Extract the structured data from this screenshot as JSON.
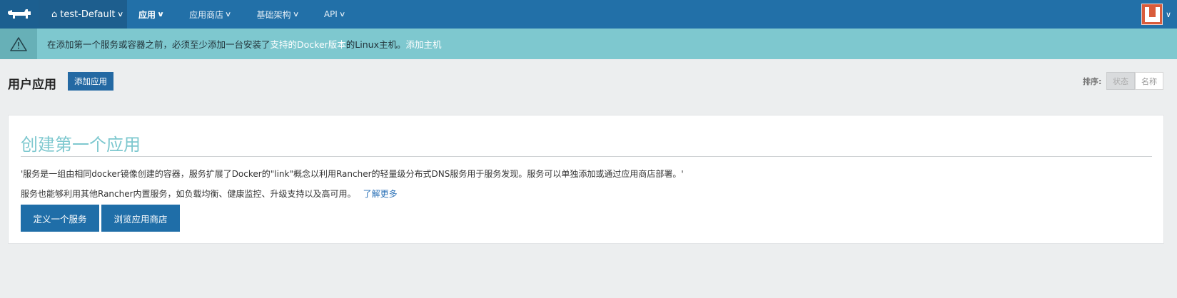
{
  "nav": {
    "environment": "test-Default",
    "items": [
      {
        "label": "应用",
        "active": true
      },
      {
        "label": "应用商店",
        "active": false
      },
      {
        "label": "基础架构",
        "active": false
      },
      {
        "label": "API",
        "active": false
      }
    ],
    "colors": {
      "bar": "#2270a8",
      "accent": "#7ec8cf"
    }
  },
  "alert": {
    "text_before": "在添加第一个服务或容器之前，必须至少添加一台安装了",
    "link1": "支持的Docker版本",
    "text_middle": "的Linux主机。",
    "link2": "添加主机"
  },
  "header": {
    "title": "用户应用",
    "add_button": "添加应用",
    "sort_label": "排序:",
    "sort_options": [
      "状态",
      "名称"
    ]
  },
  "card": {
    "title": "创建第一个应用",
    "paragraph1": "'服务是一组由相同docker镜像创建的容器，服务扩展了Docker的\"link\"概念以利用Rancher的轻量级分布式DNS服务用于服务发现。服务可以单独添加或通过应用商店部署。'",
    "paragraph2": "服务也能够利用其他Rancher内置服务，如负载均衡、健康监控、升级支持以及高可用。",
    "learn_more": "了解更多",
    "buttons": [
      "定义一个服务",
      "浏览应用商店"
    ]
  }
}
